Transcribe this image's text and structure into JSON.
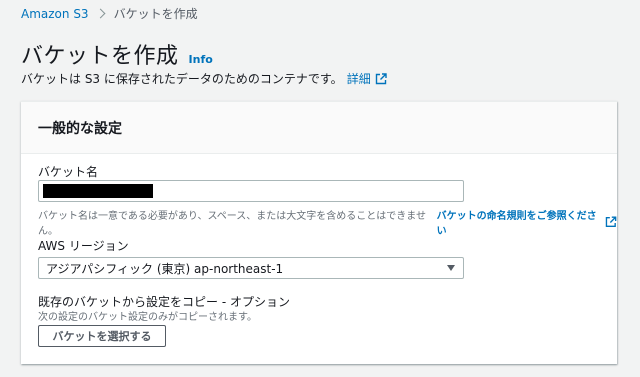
{
  "breadcrumb": {
    "root": "Amazon S3",
    "current": "バケットを作成"
  },
  "header": {
    "title": "バケットを作成",
    "info": "Info",
    "description": "バケットは S3 に保存されたデータのためのコンテナです。",
    "details_link": "詳細"
  },
  "panel": {
    "title": "一般的な設定",
    "bucket_name": {
      "label": "バケット名",
      "value": "",
      "hint": "バケット名は一意である必要があり、スペース、または大文字を含めることはできません。",
      "hint_link": "バケットの命名規則をご参照ください"
    },
    "region": {
      "label": "AWS リージョン",
      "selected": "アジアパシフィック (東京) ap-northeast-1"
    },
    "copy_settings": {
      "label": "既存のバケットから設定をコピー - オプション",
      "hint": "次の設定のバケット設定のみがコピーされます。",
      "button": "バケットを選択する"
    }
  },
  "colors": {
    "link": "#0073bb",
    "background": "#f2f3f3",
    "redaction": "#000000"
  }
}
